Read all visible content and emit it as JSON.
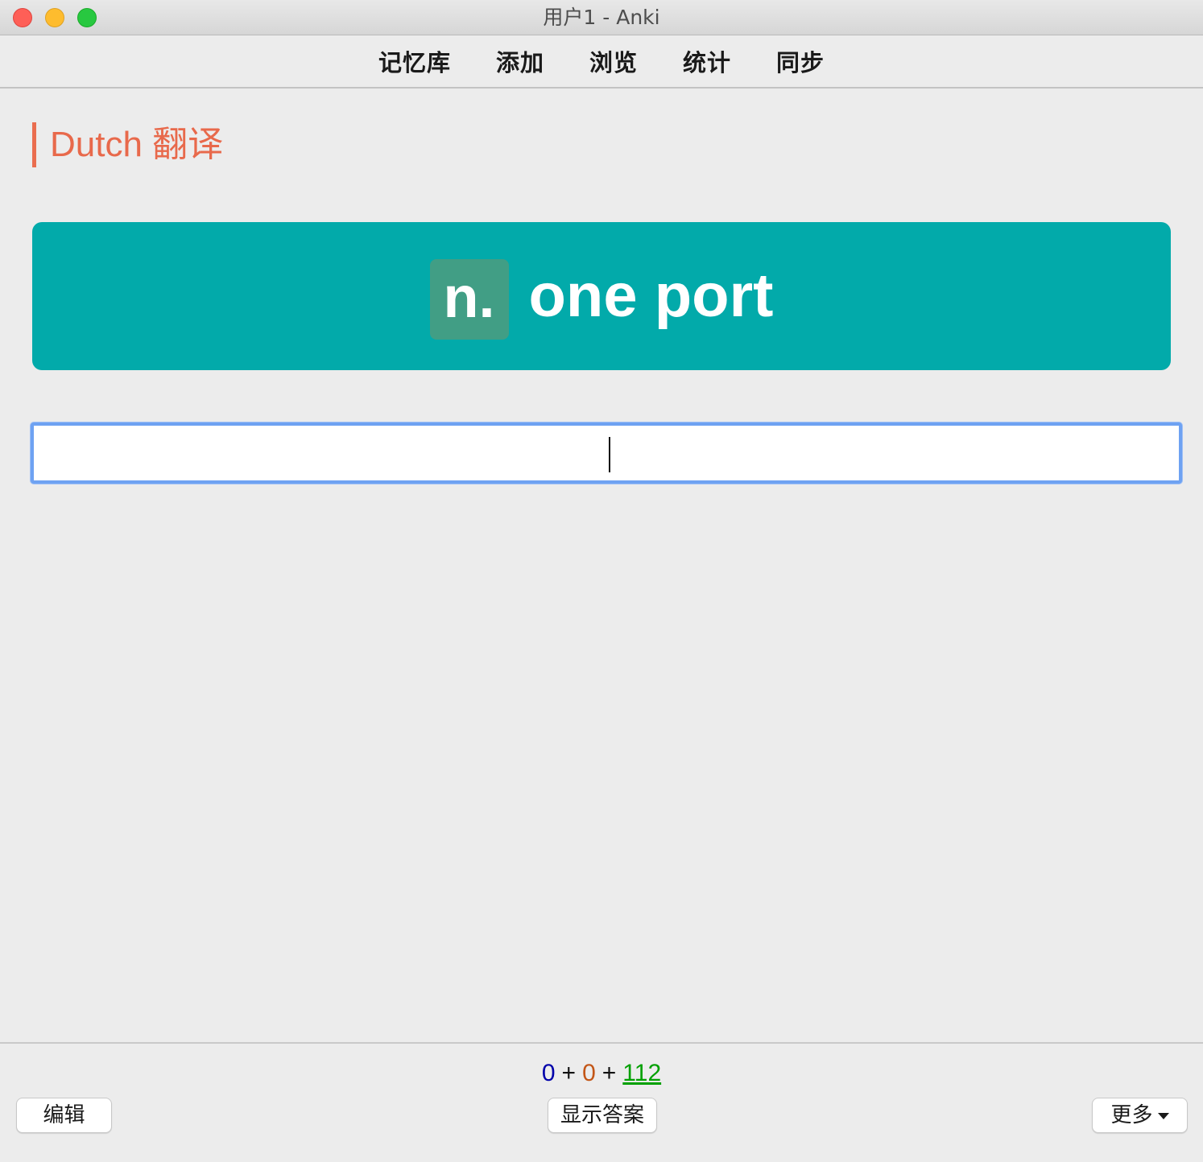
{
  "window": {
    "title": "用户1 - Anki"
  },
  "toolbar": {
    "items": [
      {
        "label": "记忆库"
      },
      {
        "label": "添加"
      },
      {
        "label": "浏览"
      },
      {
        "label": "统计"
      },
      {
        "label": "同步"
      }
    ]
  },
  "deck": {
    "heading": "Dutch 翻译"
  },
  "card": {
    "part_of_speech": "n.",
    "word": "one port",
    "banner_color": "#02aaaa",
    "badge_color": "#419e85"
  },
  "answer": {
    "value": ""
  },
  "counts": {
    "new": "0",
    "learning": "0",
    "review": "112",
    "plus": "+"
  },
  "buttons": {
    "edit": "编辑",
    "show_answer": "显示答案",
    "more": "更多"
  }
}
